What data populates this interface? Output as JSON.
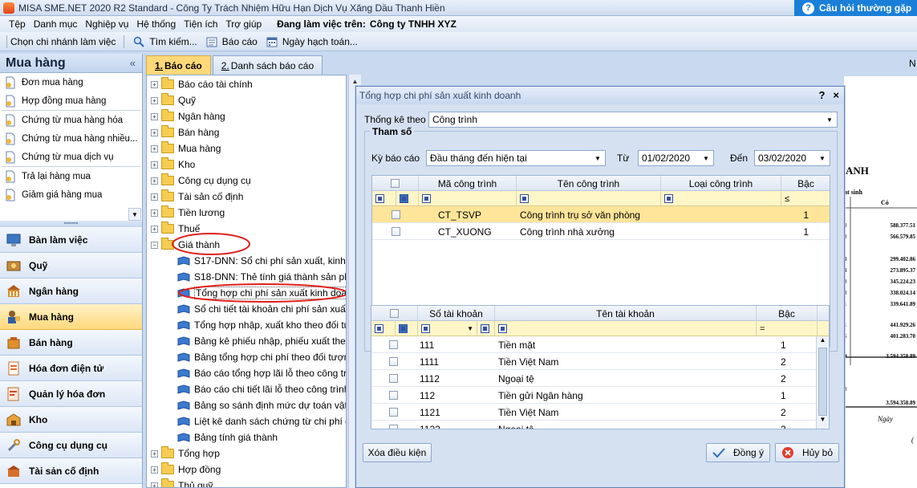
{
  "window": {
    "title": "MISA SME.NET 2020 R2 Standard - Công Ty Trách Nhiệm Hữu Hạn Dịch Vụ Xăng Dầu Thanh Hiền",
    "help_label": "Câu hỏi thường gặp"
  },
  "menu": {
    "items": [
      "Tệp",
      "Danh mục",
      "Nghiệp vụ",
      "Hệ thống",
      "Tiện ích",
      "Trợ giúp"
    ],
    "workspace_label": "Đang làm việc trên:",
    "workspace_value": "Công ty TNHH XYZ"
  },
  "toolbar": {
    "branch": "Chọn chi nhánh làm việc",
    "search": "Tìm kiếm...",
    "report": "Báo cáo",
    "date": "Ngày hạch toán..."
  },
  "sidebar": {
    "title": "Mua hàng",
    "collapse": "«",
    "items": [
      "Đơn mua hàng",
      "Hợp đồng mua hàng",
      "Chứng từ mua hàng hóa",
      "Chứng từ mua hàng nhiều...",
      "Chứng từ mua dịch vụ",
      "Trả lại hàng mua",
      "Giảm giá hàng mua"
    ],
    "modules": [
      "Bàn làm việc",
      "Quỹ",
      "Ngân hàng",
      "Mua hàng",
      "Bán hàng",
      "Hóa đơn điện tử",
      "Quản lý hóa đơn",
      "Kho",
      "Công cụ dụng cụ",
      "Tài sản cố định"
    ]
  },
  "tabs": [
    {
      "num": "1.",
      "label": "Báo cáo"
    },
    {
      "num": "2.",
      "label": "Danh sách báo cáo"
    }
  ],
  "tree": {
    "folders_top": [
      "Báo cáo tài chính",
      "Quỹ",
      "Ngân hàng",
      "Bán hàng",
      "Mua hàng",
      "Kho",
      "Công cụ dụng cụ",
      "Tài sản cố định",
      "Tiền lương",
      "Thuế"
    ],
    "open_folder": "Giá thành",
    "reports": [
      "S17-DNN: Sổ chi phí sản xuất, kinh d",
      "S18-DNN: Thẻ tính giá thành sản ph",
      "Tổng hợp chi phí sản xuất kinh doan",
      "Sổ chi tiết tài khoản chi phí sản xuất",
      "Tổng hợp nhập, xuất kho theo đối tượ",
      "Bảng kê phiếu nhập, phiếu xuất theo",
      "Bảng tổng hợp chi phí theo đối tượng",
      "Báo cáo tổng hợp lãi lỗ theo công trìn",
      "Báo cáo chi tiết lãi lỗ theo công trình",
      "Bảng so sánh định mức dự toán vật t",
      "Liệt kê danh sách chứng từ chi phí ch",
      "Bảng tính giá thành"
    ],
    "folders_bottom": [
      "Tổng hợp",
      "Hợp đồng",
      "Thủ quỹ"
    ]
  },
  "report_bg": {
    "title_fragment": "ANH",
    "col1": "at sinh",
    "col2": "Có",
    "values": [
      "588.377.51",
      "566.579.85",
      "299.402.86",
      "273.895.37",
      "345.224.23",
      "338.024.14",
      "339.641.89",
      "441.929.26",
      "401.283.70",
      "3.594.358.89",
      "3.594.358.89"
    ],
    "left_digits": [
      "0",
      "8",
      "4",
      "4",
      "3",
      "3",
      "1",
      "1",
      "5",
      "9",
      "8"
    ],
    "footer1": "Ngày",
    "footer2": "(",
    "gutter": "N"
  },
  "dialog": {
    "title": "Tổng hợp chi phí sản xuất kinh doanh",
    "help": "?",
    "close": "×",
    "stat_label": "Thống kê theo",
    "stat_value": "Công trình",
    "group_label": "Tham số",
    "period_label": "Kỳ báo cáo",
    "period_value": "Đầu tháng đến hiện tại",
    "from_label": "Từ",
    "from_value": "01/02/2020",
    "to_label": "Đến",
    "to_value": "03/02/2020",
    "grid1": {
      "headers": [
        "Mã công trình",
        "Tên công trình",
        "Loại công trình",
        "Bậc"
      ],
      "filter_op": "≤",
      "rows": [
        {
          "code": "CT_TSVP",
          "name": "Công trình trụ sở văn phòng",
          "type": "",
          "level": "1"
        },
        {
          "code": "CT_XUONG",
          "name": "Công trình nhà xưởng",
          "type": "",
          "level": "1"
        }
      ]
    },
    "grid2": {
      "headers": [
        "Số tài khoản",
        "Tên tài khoản",
        "Bậc"
      ],
      "filter_op": "=",
      "rows": [
        {
          "no": "111",
          "name": "Tiền mặt",
          "level": "1"
        },
        {
          "no": "1111",
          "name": "Tiền Việt Nam",
          "level": "2"
        },
        {
          "no": "1112",
          "name": "Ngoại tệ",
          "level": "2"
        },
        {
          "no": "112",
          "name": "Tiền gửi Ngân hàng",
          "level": "1"
        },
        {
          "no": "1121",
          "name": "Tiền Việt Nam",
          "level": "2"
        },
        {
          "no": "1122",
          "name": "Ngoại tệ",
          "level": "2"
        }
      ]
    },
    "clear_button": "Xóa điều kiện",
    "ok_button": "Đồng ý",
    "cancel_button": "Hủy bỏ"
  },
  "colors": {
    "accent_yellow": "#ffd87a",
    "selection": "#ffe59a",
    "annotation_red": "#e0201b",
    "help_blue": "#1a7fd8"
  }
}
